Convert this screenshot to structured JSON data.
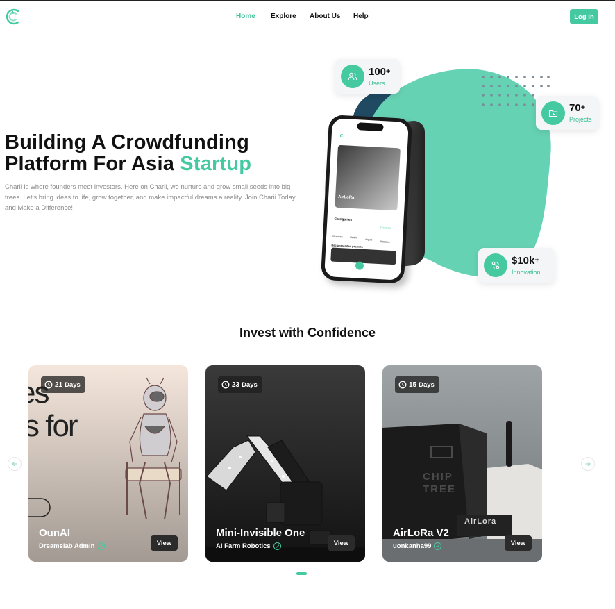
{
  "nav": {
    "links": [
      {
        "label": "Home",
        "active": true
      },
      {
        "label": "Explore",
        "active": false
      },
      {
        "label": "About Us",
        "active": false
      },
      {
        "label": "Help",
        "active": false
      }
    ],
    "login_label": "Log In"
  },
  "hero": {
    "title_line1": "Building A Crowdfunding",
    "title_line2_prefix": "Platform For Asia ",
    "title_accent": "Startup",
    "description": "Charii is where founders meet investors. Here on Charii, we nurture and grow small seeds into big trees. Let's bring ideas to life, grow together, and make impactful dreams a reality. Join Charii Today and Make a Difference!"
  },
  "stats": [
    {
      "value": "100",
      "suffix": "+",
      "label": "Users",
      "icon": "users-icon"
    },
    {
      "value": "70",
      "suffix": "+",
      "label": "Projects",
      "icon": "folder-icon"
    },
    {
      "value": "$10k",
      "suffix": "+",
      "label": "Innovation",
      "icon": "innovation-icon"
    }
  ],
  "phone_screen": {
    "project_title": "AirLoRa",
    "section_categories": "Categories",
    "see_more": "See more",
    "categories": [
      "Education",
      "Health",
      "Airport",
      "Robotics"
    ],
    "recommended": "Recommended projects"
  },
  "section": {
    "title": "Invest with Confidence"
  },
  "cards": [
    {
      "days": "21",
      "days_label": "Days",
      "title": "OunAI",
      "owner": "Dreamslab Admin",
      "view_label": "View",
      "bg_text_1": "es",
      "bg_text_2": "s for"
    },
    {
      "days": "23",
      "days_label": "Days",
      "title": "Mini-Invisible One",
      "owner": "AI Farm Robotics",
      "view_label": "View"
    },
    {
      "days": "15",
      "days_label": "Days",
      "title": "AirLoRa V2",
      "owner": "uonkanha99",
      "view_label": "View",
      "box_label": "CHIP TREE",
      "device_label": "AirLora"
    }
  ],
  "colors": {
    "accent": "#45c9a0",
    "text": "#111111",
    "muted": "#8a8a8a",
    "blob_dark": "#1f4a62"
  }
}
